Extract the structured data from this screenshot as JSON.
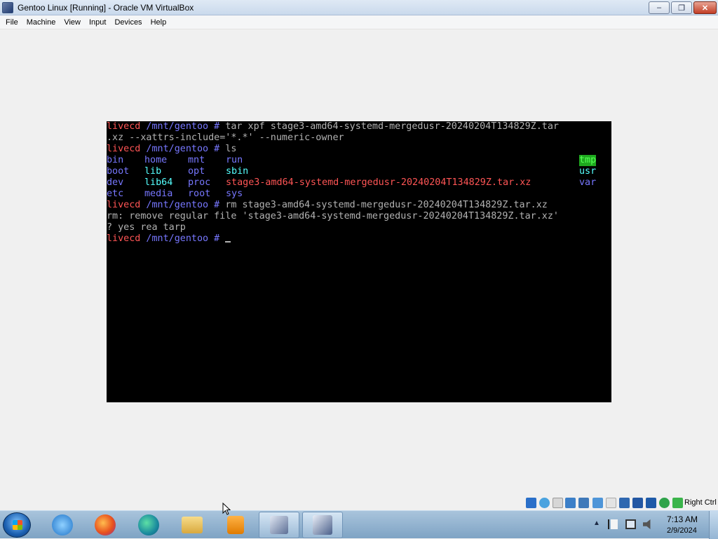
{
  "window": {
    "title": "Gentoo Linux [Running] - Oracle VM VirtualBox",
    "minimize_label": "–",
    "maximize_label": "❐",
    "close_label": "✕"
  },
  "menu": {
    "items": [
      "File",
      "Machine",
      "View",
      "Input",
      "Devices",
      "Help"
    ]
  },
  "terminal": {
    "lines": [
      {
        "prompt_user": "livecd",
        "prompt_path": " /mnt/gentoo # ",
        "cmd": "tar xpf stage3-amd64-systemd-mergedusr-20240204T134829Z.tar"
      },
      {
        "text": ".xz --xattrs-include='*.*' --numeric-owner"
      },
      {
        "prompt_user": "livecd",
        "prompt_path": " /mnt/gentoo # ",
        "cmd": "ls"
      },
      {
        "text": "rm: remove regular file 'stage3-amd64-systemd-mergedusr-20240204T134829Z.tar.xz'"
      },
      {
        "text": "? yes rea tarp"
      },
      {
        "prompt_user": "livecd",
        "prompt_path": " /mnt/gentoo # ",
        "cmd": ""
      }
    ],
    "rm_line": {
      "prompt_user": "livecd",
      "prompt_path": " /mnt/gentoo # ",
      "cmd": "rm stage3-amd64-systemd-mergedusr-20240204T134829Z.tar.xz"
    },
    "ls_columns": [
      [
        "bin",
        "boot",
        "dev",
        "etc"
      ],
      [
        "home",
        "lib",
        "lib64",
        "media"
      ],
      [
        "mnt",
        "opt",
        "proc",
        "root"
      ],
      [
        "run",
        "sbin",
        "stage3-amd64-systemd-mergedusr-20240204T134829Z.tar.xz",
        "sys"
      ],
      [
        "tmp",
        "usr",
        "var"
      ]
    ],
    "colors": {
      "prompt": "#ff5555",
      "path": "#7777ff",
      "dir": "#7777ff",
      "link_dir": "#55ffff",
      "archive": "#ff5555",
      "sticky_bg": "#1fa81f"
    }
  },
  "statusbar": {
    "host_key": "Right Ctrl",
    "icons": [
      "hard-disk-icon",
      "optical-drive-icon",
      "floppy-icon",
      "audio-icon",
      "network-icon",
      "usb-icon",
      "shared-folder-icon",
      "display-icon",
      "recording-icon",
      "cpu-icon",
      "mouse-integration-icon",
      "keyboard-icon"
    ]
  },
  "taskbar": {
    "apps": [
      "internet-explorer-icon",
      "firefox-icon",
      "edge-icon",
      "file-explorer-icon",
      "media-player-icon",
      "virtualbox-icon",
      "vm-window-icon"
    ],
    "time": "7:13 AM",
    "date": "2/9/2024",
    "tray_icons": [
      "show-hidden-icons-icon",
      "action-center-flag-icon",
      "network-icon",
      "volume-muted-icon"
    ]
  }
}
